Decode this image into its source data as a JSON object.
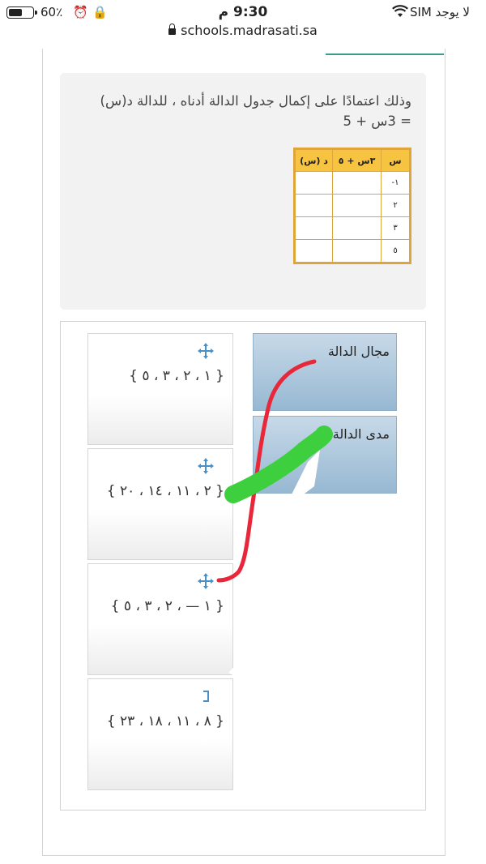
{
  "status_bar": {
    "carrier": "لا يوجد SIM",
    "time": "9:30 م",
    "battery_percent": "60٪",
    "battery_level": 0.6
  },
  "browser": {
    "url": "schools.madrasati.sa"
  },
  "question": {
    "text": "وذلك اعتمادًا على إكمال جدول الدالة أدناه ، للدالة  د(س) = 3س + 5",
    "table": {
      "headers": [
        "س",
        "٣س + ٥",
        "د (س)"
      ],
      "x_values": [
        "١-",
        "٢",
        "٣",
        "٥"
      ]
    }
  },
  "matching": {
    "targets": [
      {
        "label": "مجال الدالة"
      },
      {
        "label": "مدى الدالة"
      }
    ],
    "options": [
      {
        "value": "{ ١ ، ٢ ، ٣ ، ٥ }"
      },
      {
        "value": "{ ٢ ، ١١ ، ١٤ ، ٢٠ }"
      },
      {
        "value": "{ ١ — ، ٢ ، ٣ ، ٥ }"
      },
      {
        "value": "{ ٨ ، ١١ ، ١٨ ، ٢٣ }"
      }
    ]
  },
  "colors": {
    "accent_teal": "#3a9b8e",
    "table_border": "#e0a53a",
    "table_header": "#f7c442",
    "target_blue": "#97b8d2",
    "move_icon": "#4a90c8",
    "scribble_red": "#e8273a",
    "scribble_green": "#3ecf3e"
  },
  "icons": {
    "status": [
      "wifi-icon",
      "alarm-icon",
      "rotation-lock-icon",
      "battery-icon"
    ],
    "url": "lock-icon",
    "drag": "move-arrows-icon"
  }
}
